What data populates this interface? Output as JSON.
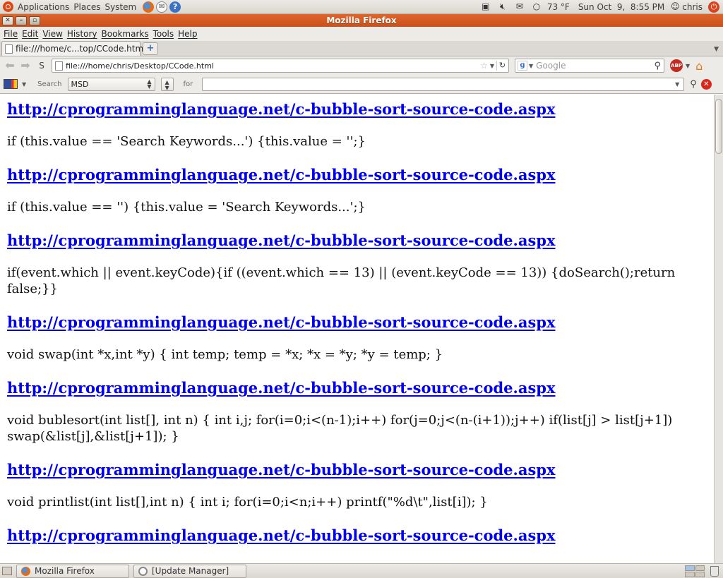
{
  "panel": {
    "menus": [
      "Applications",
      "Places",
      "System"
    ],
    "weather": "73 °F",
    "clock": "Sun Oct  9,  8:55 PM",
    "user": "chris"
  },
  "window": {
    "title": "Mozilla Firefox"
  },
  "menubar": [
    "File",
    "Edit",
    "View",
    "History",
    "Bookmarks",
    "Tools",
    "Help"
  ],
  "tabs": [
    {
      "label": "file:///home/c...top/CCode.html"
    }
  ],
  "navigation": {
    "url": "file:///home/chris/Desktop/CCode.html",
    "search_placeholder": "Google"
  },
  "msd_toolbar": {
    "search_label": "Search",
    "selected_source": "MSD",
    "for_label": "for"
  },
  "content": {
    "link": "http://cprogramminglanguage.net/c-bubble-sort-source-code.aspx",
    "blocks": [
      {
        "link": "http://cprogramminglanguage.net/c-bubble-sort-source-code.aspx",
        "code": "if (this.value == 'Search Keywords...') {this.value = '';}"
      },
      {
        "link": "http://cprogramminglanguage.net/c-bubble-sort-source-code.aspx",
        "code": "if (this.value == '') {this.value = 'Search Keywords...';}"
      },
      {
        "link": "http://cprogramminglanguage.net/c-bubble-sort-source-code.aspx",
        "code": "if(event.which || event.keyCode){if ((event.which == 13) || (event.keyCode == 13)) {doSearch();return false;}}"
      },
      {
        "link": "http://cprogramminglanguage.net/c-bubble-sort-source-code.aspx",
        "code": "void swap(int *x,int *y) { int temp; temp = *x; *x = *y; *y = temp; }"
      },
      {
        "link": "http://cprogramminglanguage.net/c-bubble-sort-source-code.aspx",
        "code": "void bublesort(int list[], int n) { int i,j; for(i=0;i<(n-1);i++) for(j=0;j<(n-(i+1));j++) if(list[j] > list[j+1]) swap(&list[j],&list[j+1]); }"
      },
      {
        "link": "http://cprogramminglanguage.net/c-bubble-sort-source-code.aspx",
        "code": "void printlist(int list[],int n) { int i; for(i=0;i<n;i++) printf(\"%d\\t\",list[i]); }"
      },
      {
        "link": "http://cprogramminglanguage.net/c-bubble-sort-source-code.aspx",
        "code": ""
      }
    ]
  },
  "taskbar": [
    {
      "label": "Mozilla Firefox"
    },
    {
      "label": "[Update Manager]"
    }
  ],
  "colors": {
    "link": "#0000ee",
    "title_bar": "#d85a22",
    "panel": "#e3e0db"
  }
}
